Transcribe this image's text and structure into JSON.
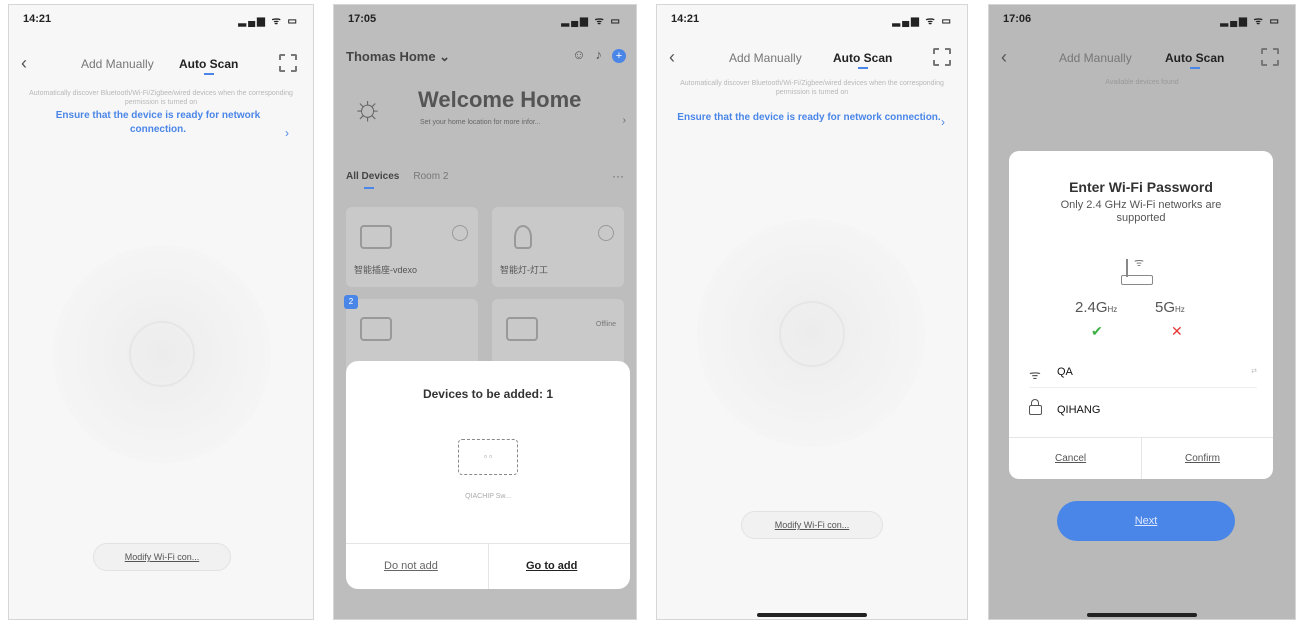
{
  "panel1": {
    "time": "14:21",
    "signal": "▂▄▆ ᯤ ▭",
    "tab_manual": "Add Manually",
    "tab_auto": "Auto Scan",
    "hint": "Automatically discover Bluetooth/Wi-Fi/Zigbee/wired devices when the corresponding permission is turned on",
    "ensure": "Ensure that the device is ready for network connection.",
    "modify": "Modify Wi-Fi con..."
  },
  "panel2": {
    "time": "17:05",
    "home_title": "Thomas Home ⌄",
    "welcome": "Welcome Home",
    "welcome_sub": "Set your home location for more infor...",
    "room_all": "All Devices",
    "room_2": "Room 2",
    "more": "···",
    "card1_name": "智能插座-vdexo",
    "card2_name": "智能灯-灯工",
    "card4_status": "Offline",
    "badge": "2",
    "sheet_title": "Devices to be added: 1",
    "sheet_device": "QIACHIP Sw...",
    "btn_no": "Do not add",
    "btn_go": "Go to add"
  },
  "panel3": {
    "time": "14:21",
    "tab_manual": "Add Manually",
    "tab_auto": "Auto Scan",
    "hint": "Automatically discover Bluetooth/Wi-Fi/Zigbee/wired devices when the corresponding permission is turned on",
    "ensure": "Ensure that the device is ready for network connection.",
    "modify": "Modify Wi-Fi con..."
  },
  "panel4": {
    "time": "17:06",
    "tab_manual": "Add Manually",
    "tab_auto": "Auto Scan",
    "avail": "Available devices found",
    "dialog_title": "Enter Wi-Fi Password",
    "dialog_sub": "Only 2.4 GHz Wi-Fi networks are supported",
    "band24": "2.4G",
    "band5": "5G",
    "hz": "Hz",
    "ssid": "QA",
    "switch_label": "⇄",
    "password": "QIHANG",
    "cancel": "Cancel",
    "confirm": "Confirm",
    "next": "Next"
  },
  "colors": {
    "accent": "#4a86e8",
    "ok": "#3cb043",
    "error": "#e53935"
  }
}
